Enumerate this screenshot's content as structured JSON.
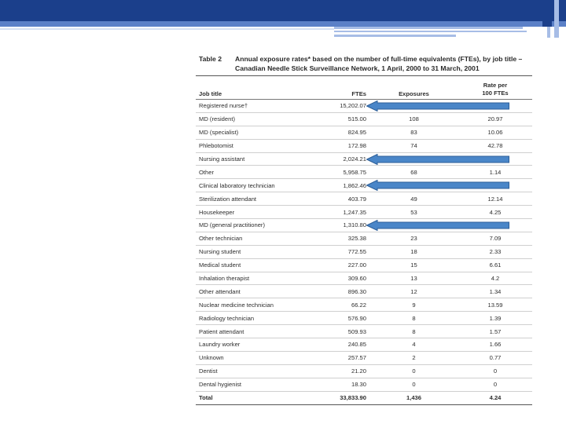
{
  "theme": {
    "dark_blue": "#1b3f8b",
    "mid_blue": "#5b80c7",
    "light_blue": "#a7bde6",
    "arrow_fill": "#4a86c8",
    "arrow_stroke": "#2d5f98"
  },
  "table": {
    "number": "Table 2",
    "title": "Annual exposure rates* based on the number of full-time equivalents (FTEs), by job title – Canadian Needle Stick Surveillance Network, 1 April, 2000 to 31 March, 2001",
    "headers": {
      "job_title": "Job title",
      "ftes": "FTEs",
      "exposures": "Exposures",
      "rate_line1": "Rate per",
      "rate_line2": "100 FTEs"
    },
    "rows": [
      [
        "Registered nurse†",
        "15,202.07",
        "",
        ""
      ],
      [
        "MD (resident)",
        "515.00",
        "108",
        "20.97"
      ],
      [
        "MD (specialist)",
        "824.95",
        "83",
        "10.06"
      ],
      [
        "Phlebotomist",
        "172.98",
        "74",
        "42.78"
      ],
      [
        "Nursing assistant",
        "2,024.21",
        "",
        ""
      ],
      [
        "Other",
        "5,958.75",
        "68",
        "1.14"
      ],
      [
        "Clinical laboratory technician",
        "1,862.46",
        "",
        ""
      ],
      [
        "Sterilization attendant",
        "403.79",
        "49",
        "12.14"
      ],
      [
        "Housekeeper",
        "1,247.35",
        "53",
        "4.25"
      ],
      [
        "MD (general practitioner)",
        "1,310.80",
        "",
        ""
      ],
      [
        "Other technician",
        "325.38",
        "23",
        "7.09"
      ],
      [
        "Nursing student",
        "772.55",
        "18",
        "2.33"
      ],
      [
        "Medical student",
        "227.00",
        "15",
        "6.61"
      ],
      [
        "Inhalation therapist",
        "309.60",
        "13",
        "4.2"
      ],
      [
        "Other attendant",
        "896.30",
        "12",
        "1.34"
      ],
      [
        "Nuclear medicine technician",
        "66.22",
        "9",
        "13.59"
      ],
      [
        "Radiology technician",
        "576.90",
        "8",
        "1.39"
      ],
      [
        "Patient attendant",
        "509.93",
        "8",
        "1.57"
      ],
      [
        "Laundry worker",
        "240.85",
        "4",
        "1.66"
      ],
      [
        "Unknown",
        "257.57",
        "2",
        "0.77"
      ],
      [
        "Dentist",
        "21.20",
        "0",
        "0"
      ],
      [
        "Dental hygienist",
        "18.30",
        "0",
        "0"
      ]
    ],
    "total": [
      "Total",
      "33,833.90",
      "1,436",
      "4.24"
    ]
  },
  "arrows": [
    {
      "row": 0,
      "label": "left-arrow-registered-nurse"
    },
    {
      "row": 4,
      "label": "left-arrow-nursing-assistant"
    },
    {
      "row": 6,
      "label": "left-arrow-clinical-laboratory-technician"
    },
    {
      "row": 9,
      "label": "left-arrow-md-general-practitioner"
    }
  ]
}
